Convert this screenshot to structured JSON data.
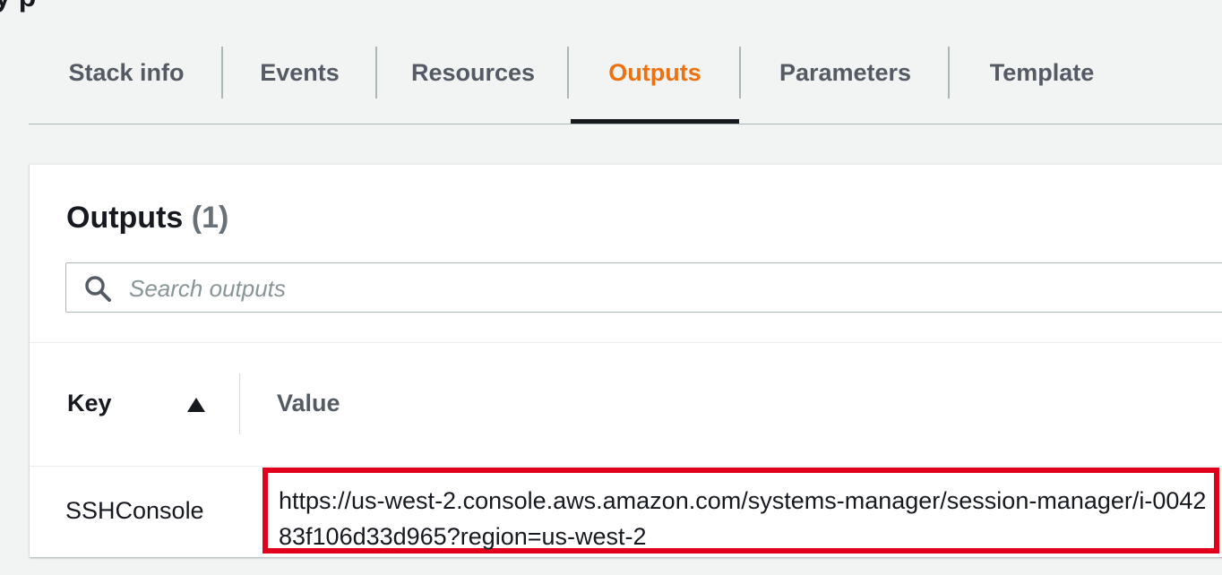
{
  "page": {
    "partial_title": "y  p"
  },
  "tabs": [
    {
      "label": "Stack info",
      "active": false
    },
    {
      "label": "Events",
      "active": false
    },
    {
      "label": "Resources",
      "active": false
    },
    {
      "label": "Outputs",
      "active": true
    },
    {
      "label": "Parameters",
      "active": false
    },
    {
      "label": "Template",
      "active": false
    }
  ],
  "outputs_panel": {
    "title": "Outputs",
    "count": "(1)",
    "search": {
      "placeholder": "Search outputs",
      "value": "",
      "icon": "search-icon"
    },
    "table": {
      "columns": [
        {
          "label": "Key",
          "sort": "ascending"
        },
        {
          "label": "Value"
        }
      ],
      "rows": [
        {
          "key": "SSHConsole",
          "value": "https://us-west-2.console.aws.amazon.com/systems-manager/session-manager/i-004283f106d33d965?region=us-west-2"
        }
      ]
    }
  },
  "colors": {
    "active_tab": "#ec7211",
    "highlight_border": "#e0001b",
    "text_primary": "#16191f",
    "text_secondary": "#545b64",
    "background": "#f2f3f3"
  }
}
